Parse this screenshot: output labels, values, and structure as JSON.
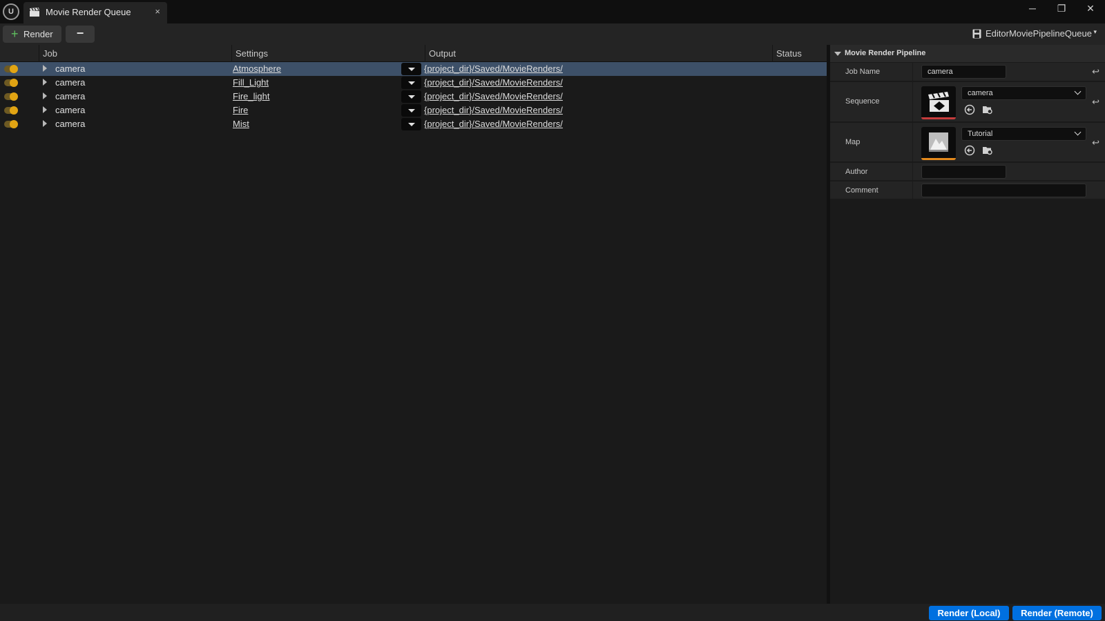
{
  "window": {
    "tab_title": "Movie Render Queue",
    "tab_close": "×",
    "minimize": "─",
    "restore": "❐",
    "close": "✕"
  },
  "toolbar": {
    "render_plus": "+",
    "render_label": "Render",
    "remove_label": "−",
    "queue_name": "EditorMoviePipelineQueue",
    "queue_arrow": "▾"
  },
  "columns": {
    "job": "Job",
    "settings": "Settings",
    "output": "Output",
    "status": "Status"
  },
  "jobs": [
    {
      "name": "camera",
      "settings": "Atmosphere",
      "output": "{project_dir}/Saved/MovieRenders/",
      "status": "",
      "selected": true
    },
    {
      "name": "camera",
      "settings": "Fill_Light",
      "output": "{project_dir}/Saved/MovieRenders/",
      "status": "",
      "selected": false
    },
    {
      "name": "camera",
      "settings": "Fire_light",
      "output": "{project_dir}/Saved/MovieRenders/",
      "status": "",
      "selected": false
    },
    {
      "name": "camera",
      "settings": "Fire",
      "output": "{project_dir}/Saved/MovieRenders/",
      "status": "",
      "selected": false
    },
    {
      "name": "camera",
      "settings": "Mist",
      "output": "{project_dir}/Saved/MovieRenders/",
      "status": "",
      "selected": false
    }
  ],
  "details": {
    "section_title": "Movie Render Pipeline",
    "job_name_label": "Job Name",
    "job_name_value": "camera",
    "sequence_label": "Sequence",
    "sequence_value": "camera",
    "map_label": "Map",
    "map_value": "Tutorial",
    "author_label": "Author",
    "author_value": "",
    "comment_label": "Comment",
    "comment_value": "",
    "reset_glyph": "↩"
  },
  "bottom": {
    "render_local": "Render (Local)",
    "render_remote": "Render (Remote)"
  },
  "icons": {
    "tab": "clapperboard-icon",
    "save": "save-icon",
    "browse": "browse-to-asset-icon",
    "find": "find-in-content-browser-icon"
  },
  "colors": {
    "accent_primary": "#0070e0",
    "toggle_on": "#e1a413",
    "selected_row": "#3d5068",
    "sequence_thumb_underline": "#c83c3c",
    "map_thumb_underline": "#e58a1c"
  }
}
